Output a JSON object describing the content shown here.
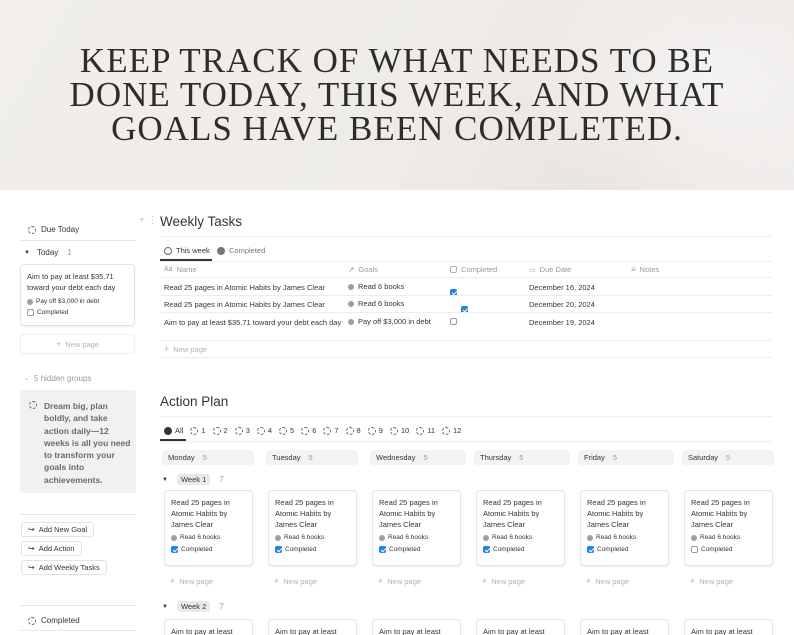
{
  "hero": {
    "headline_lines": [
      "KEEP TRACK OF WHAT NEEDS TO BE",
      "DONE TODAY, THIS WEEK, AND WHAT",
      "GOALS HAVE BEEN COMPLETED."
    ]
  },
  "left": {
    "due_today_title": "Due Today",
    "today_group": {
      "label": "Today",
      "count": "1"
    },
    "today_card": {
      "title": "Aim to pay at least $35.71 toward your debt each day",
      "goal": "Pay off $3,000 in debt",
      "status": "Completed"
    },
    "new_page_label": "New page",
    "hidden_groups": "5 hidden groups",
    "callout_text": "Dream big, plan boldly, and take action daily—12 weeks is all you need to transform your goals into achievements.",
    "buttons": [
      "Add New Goal",
      "Add Action",
      "Add Weekly Tasks"
    ],
    "completed_title": "Completed"
  },
  "weekly": {
    "title": "Weekly Tasks",
    "tabs": [
      "This week",
      "Completed"
    ],
    "columns": [
      "Name",
      "Goals",
      "Completed",
      "Due Date",
      "Notes"
    ],
    "rows": [
      {
        "name": "Read 25 pages in Atomic Habits by James Clear",
        "goal": "Read 6 books",
        "done": true,
        "date": "December 16, 2024"
      },
      {
        "name": "Read 25 pages in Atomic Habits by James Clear",
        "goal": "Read 6 books",
        "done": true,
        "date": "December 20, 2024"
      },
      {
        "name": "Aim to pay at least $35.71 toward your debt each day",
        "goal": "Pay off $3,000 in debt",
        "done": false,
        "date": "December 19, 2024"
      }
    ],
    "new_page_label": "New page"
  },
  "action": {
    "title": "Action Plan",
    "filter_tabs": [
      "All",
      "1",
      "2",
      "3",
      "4",
      "5",
      "6",
      "7",
      "8",
      "9",
      "10",
      "11",
      "12"
    ],
    "days": [
      {
        "name": "Monday",
        "count": "5"
      },
      {
        "name": "Tuesday",
        "count": "5"
      },
      {
        "name": "Wednesday",
        "count": "5"
      },
      {
        "name": "Thursday",
        "count": "5"
      },
      {
        "name": "Friday",
        "count": "5"
      },
      {
        "name": "Saturday",
        "count": "5"
      }
    ],
    "week1": {
      "label": "Week 1",
      "count": "7"
    },
    "week2": {
      "label": "Week 2",
      "count": "7"
    },
    "week1_cards": [
      {
        "title": "Read 25 pages in Atomic Habits by James Clear",
        "goal": "Read 6 books",
        "status": "Completed",
        "done": true
      },
      {
        "title": "Read 25 pages in Atomic Habits by James Clear",
        "goal": "Read 6 books",
        "status": "Completed",
        "done": true
      },
      {
        "title": "Read 25 pages in Atomic Habits by James Clear",
        "goal": "Read 6 books",
        "status": "Completed",
        "done": true
      },
      {
        "title": "Read 25 pages in Atomic Habits by James Clear",
        "goal": "Read 6 books",
        "status": "Completed",
        "done": true
      },
      {
        "title": "Read 25 pages in Atomic Habits by James Clear",
        "goal": "Read 6 books",
        "status": "Completed",
        "done": true
      },
      {
        "title": "Read 25 pages in Atomic Habits by James Clear",
        "goal": "Read 6 books",
        "status": "Completed",
        "done": false
      }
    ],
    "week2_card_title": "Aim to pay at least",
    "new_page_label": "New page"
  },
  "colors": {
    "checkbox_blue": "#2383e2",
    "goal_dot": "#a39e93",
    "hero_bg": "#eeebe8"
  }
}
